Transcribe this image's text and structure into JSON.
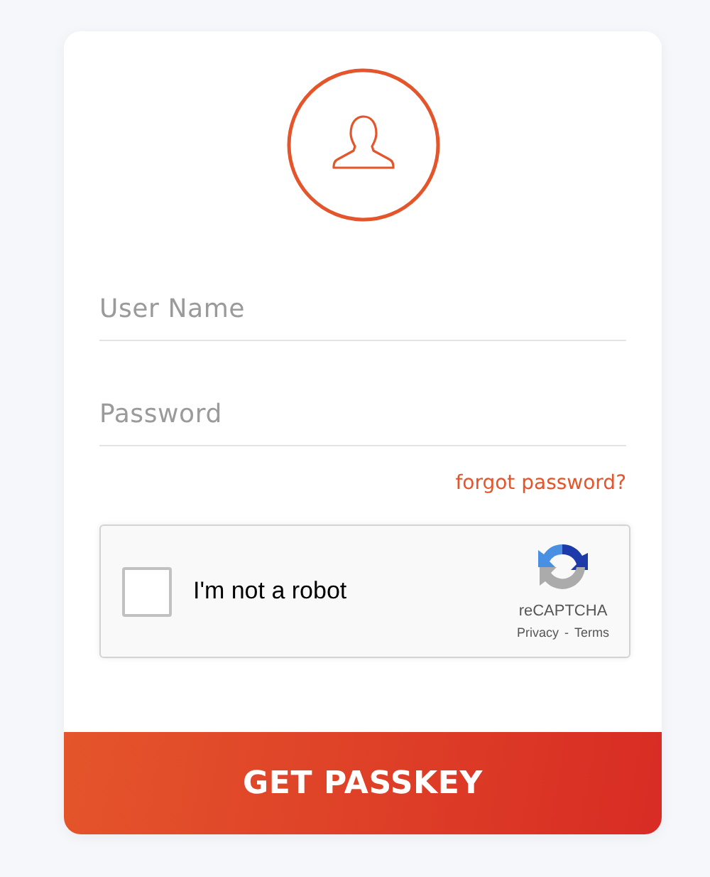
{
  "fields": [
    {
      "placeholder": "User Name"
    },
    {
      "placeholder": "Password"
    }
  ],
  "forgot_link": "forgot password?",
  "captcha": {
    "label": "I'm not a robot",
    "checked": false,
    "brand": "reCAPTCHA",
    "privacy": "Privacy",
    "separator": "-",
    "terms": "Terms"
  },
  "submit_button": "GET PASSKEY"
}
